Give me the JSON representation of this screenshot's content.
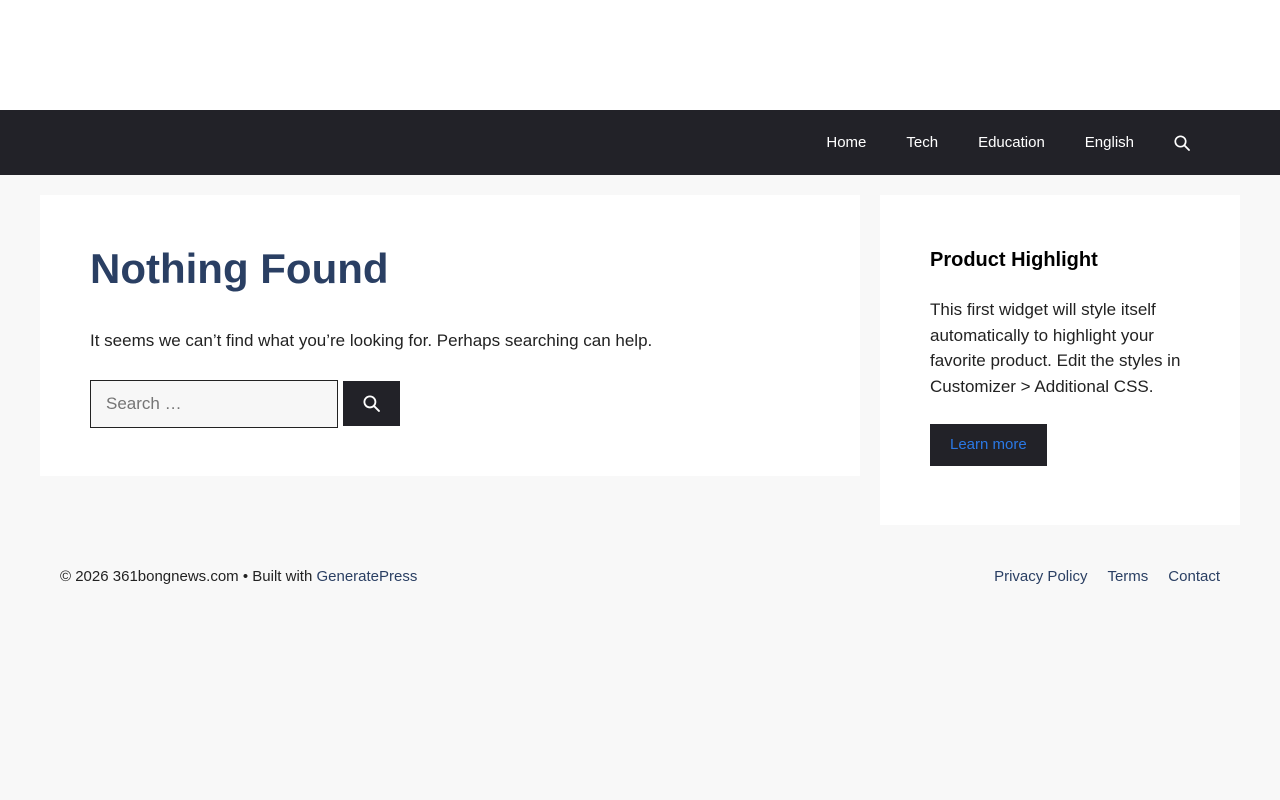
{
  "nav": {
    "items": [
      {
        "label": "Home"
      },
      {
        "label": "Tech"
      },
      {
        "label": "Education"
      },
      {
        "label": "English"
      }
    ],
    "search_icon": "search-icon"
  },
  "content": {
    "title": "Nothing Found",
    "text": "It seems we can’t find what you’re looking for. Perhaps searching can help.",
    "search": {
      "placeholder": "Search …",
      "value": "",
      "button_icon": "search-icon"
    }
  },
  "sidebar": {
    "widget_title": "Product Highlight",
    "widget_text": "This first widget will style itself automatically to highlight your favorite product. Edit the styles in Customizer > Additional CSS.",
    "button_label": "Learn more"
  },
  "footer": {
    "copyright": "© 2026 361bongnews.com",
    "separator": " • Built with ",
    "builder": "GeneratePress",
    "links": [
      {
        "label": "Privacy Policy"
      },
      {
        "label": "Terms"
      },
      {
        "label": "Contact"
      }
    ]
  },
  "colors": {
    "nav_bg": "#222228",
    "title": "#2a3f63",
    "link": "#2a3f63",
    "button_text": "#2a78e4",
    "page_bg": "#f8f8f8"
  }
}
